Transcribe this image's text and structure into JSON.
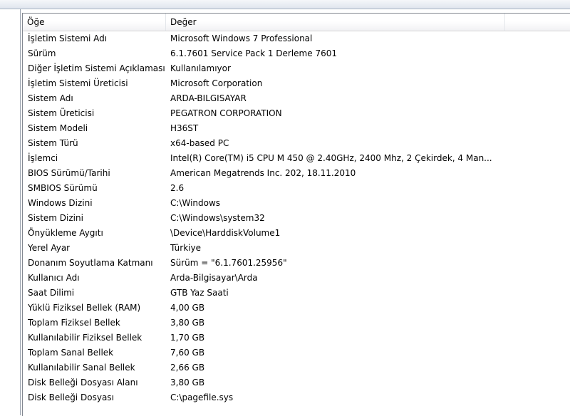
{
  "header": {
    "item_col": "Öğe",
    "value_col": "Değer"
  },
  "rows": [
    {
      "item": "İşletim Sistemi Adı",
      "value": "Microsoft Windows 7 Professional"
    },
    {
      "item": "Sürüm",
      "value": "6.1.7601 Service Pack 1 Derleme 7601"
    },
    {
      "item": "Diğer İşletim Sistemi Açıklaması",
      "value": "Kullanılamıyor"
    },
    {
      "item": "İşletim Sistemi Üreticisi",
      "value": "Microsoft Corporation"
    },
    {
      "item": "Sistem Adı",
      "value": "ARDA-BILGISAYAR"
    },
    {
      "item": "Sistem Üreticisi",
      "value": "PEGATRON CORPORATION"
    },
    {
      "item": "Sistem Modeli",
      "value": "H36ST"
    },
    {
      "item": "Sistem Türü",
      "value": "x64-based PC"
    },
    {
      "item": "İşlemci",
      "value": "Intel(R) Core(TM) i5 CPU       M 450  @ 2.40GHz, 2400 Mhz, 2 Çekirdek, 4 Man..."
    },
    {
      "item": "BIOS Sürümü/Tarihi",
      "value": "American Megatrends Inc. 202, 18.11.2010"
    },
    {
      "item": "SMBIOS Sürümü",
      "value": "2.6"
    },
    {
      "item": "Windows Dizini",
      "value": "C:\\Windows"
    },
    {
      "item": "Sistem Dizini",
      "value": "C:\\Windows\\system32"
    },
    {
      "item": "Önyükleme Aygıtı",
      "value": "\\Device\\HarddiskVolume1"
    },
    {
      "item": "Yerel Ayar",
      "value": "Türkiye"
    },
    {
      "item": "Donanım Soyutlama Katmanı",
      "value": "Sürüm = \"6.1.7601.25956\""
    },
    {
      "item": "Kullanıcı Adı",
      "value": "Arda-Bilgisayar\\Arda"
    },
    {
      "item": "Saat Dilimi",
      "value": "GTB Yaz Saati"
    },
    {
      "item": "Yüklü Fiziksel Bellek (RAM)",
      "value": "4,00 GB"
    },
    {
      "item": "Toplam Fiziksel Bellek",
      "value": "3,80 GB"
    },
    {
      "item": "Kullanılabilir Fiziksel Bellek",
      "value": "1,70 GB"
    },
    {
      "item": "Toplam Sanal Bellek",
      "value": "7,60 GB"
    },
    {
      "item": "Kullanılabilir Sanal Bellek",
      "value": "2,66 GB"
    },
    {
      "item": "Disk Belleği Dosyası Alanı",
      "value": "3,80 GB"
    },
    {
      "item": "Disk Belleği Dosyası",
      "value": "C:\\pagefile.sys"
    }
  ]
}
